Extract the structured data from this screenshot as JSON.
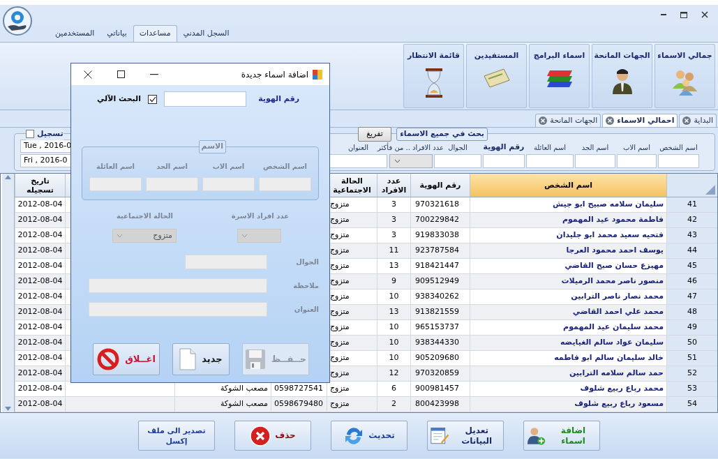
{
  "ribbon_tabs": [
    {
      "label": "السجل المدني",
      "selected": false
    },
    {
      "label": "مساعدات",
      "selected": true
    },
    {
      "label": "بياناتي",
      "selected": false
    },
    {
      "label": "المستخدمين",
      "selected": false
    }
  ],
  "ribbon_buttons": [
    {
      "label": "جمالي الاسماء"
    },
    {
      "label": "الجهات المانحة"
    },
    {
      "label": "اسماء البرامج"
    },
    {
      "label": "المستفيدين"
    },
    {
      "label": "قائمة الانتظار"
    }
  ],
  "doc_tabs": [
    {
      "label": "البداية",
      "selected": false
    },
    {
      "label": "احمالي الاسماء",
      "selected": true
    },
    {
      "label": "الجهات المانحة",
      "selected": false
    }
  ],
  "date_filter": {
    "title": "تسجيل",
    "checked": false,
    "dates": [
      "Tue , 2016-0",
      "Fri , 2016-0"
    ]
  },
  "search": {
    "title": "بحث في جميع الاسماء",
    "clear_button": "تفريغ",
    "fields": [
      {
        "label": "اسم الشخص",
        "kind": "text",
        "emphasis": false
      },
      {
        "label": "اسم الاب",
        "kind": "text",
        "emphasis": false
      },
      {
        "label": "اسم الجد",
        "kind": "text",
        "emphasis": false
      },
      {
        "label": "اسم العائلة",
        "kind": "text",
        "emphasis": false
      },
      {
        "label": "رقم الهوية",
        "kind": "text",
        "emphasis": true
      },
      {
        "label": "الجوال",
        "kind": "text",
        "emphasis": false
      },
      {
        "label": "عدد الافراد .. من فأكثر",
        "kind": "dropdown",
        "emphasis": false
      },
      {
        "label": "العنوان",
        "kind": "text",
        "emphasis": false
      }
    ]
  },
  "table": {
    "columns": [
      {
        "label": "اسم الشخص",
        "selected": true
      },
      {
        "label": "رقم الهوية",
        "selected": false
      },
      {
        "label": "عدد الافراد",
        "selected": false
      },
      {
        "label": "الحالة الاجتماعية",
        "selected": false
      },
      {
        "label": "تاريخ تسجيله",
        "selected": false
      }
    ],
    "rows": [
      {
        "number": "41",
        "name": "سليمان سلامه صبيح ابو جيش",
        "id": "970321618",
        "members": "3",
        "status": "متزوج",
        "date": "2012-08-04"
      },
      {
        "number": "42",
        "name": "فاطمة محمود عيد المهموم",
        "id": "700229842",
        "members": "3",
        "status": "متزوج",
        "date": "2012-08-04"
      },
      {
        "number": "43",
        "name": "فتحيه سعيد محمد ابو جليدان",
        "id": "919833038",
        "members": "3",
        "status": "متزوج",
        "date": "2012-08-04"
      },
      {
        "number": "44",
        "name": "يوسف احمد محمود العرجا",
        "id": "923787584",
        "members": "11",
        "status": "متزوج",
        "date": "2012-08-04"
      },
      {
        "number": "45",
        "name": "مهيزع حسان صبح القاضي",
        "id": "918421447",
        "members": "13",
        "status": "متزوج",
        "date": "2012-08-04"
      },
      {
        "number": "46",
        "name": "منصور ناصر محمد الرميلات",
        "id": "909512949",
        "members": "9",
        "status": "متزوج",
        "date": "2012-08-04"
      },
      {
        "number": "47",
        "name": "محمد نصار ناصر الترابين",
        "id": "938340262",
        "members": "10",
        "status": "متزوج",
        "date": "2012-08-04"
      },
      {
        "number": "48",
        "name": "محمد علي احمد القاضي",
        "id": "913821559",
        "members": "13",
        "status": "متزوج",
        "date": "2012-08-04"
      },
      {
        "number": "49",
        "name": "محمد سليمان عيد المهموم",
        "id": "965153737",
        "members": "10",
        "status": "متزوج",
        "date": "2012-08-04"
      },
      {
        "number": "50",
        "name": "سليمان عواد سالم الغيايضه",
        "id": "938344330",
        "members": "10",
        "status": "متزوج",
        "date": "2012-08-04"
      },
      {
        "number": "51",
        "name": "خالد سليمان سالم ابو فاطمه",
        "id": "905209680",
        "members": "10",
        "status": "متزوج",
        "date": "2012-08-04"
      },
      {
        "number": "52",
        "name": "حمد سالم سلامه الترابين",
        "id": "970320859",
        "members": "12",
        "status": "متزوج",
        "date": "2012-08-04"
      },
      {
        "number": "53",
        "name": "محمد رباع ربيع شلوف",
        "id": "900981457",
        "members": "6",
        "status": "متزوج",
        "phone": "0598727541",
        "contact": "مصعب الشوكة",
        "date": "2012-08-04"
      },
      {
        "number": "54",
        "name": "مسعود رباع ربيع شلوف",
        "id": "800423998",
        "members": "2",
        "status": "متزوج",
        "phone": "0598679480",
        "contact": "مصعب الشوكة",
        "date": "2012-08-04"
      }
    ]
  },
  "bottom_buttons": [
    {
      "label": "اضافة اسماء",
      "color": "#1f8a1f"
    },
    {
      "label": "تعديل البيانات",
      "color": "#1a2a6c"
    },
    {
      "label": "تحديث",
      "color": "#1f3f9a"
    },
    {
      "label": "حذف",
      "color": "#8b1010"
    },
    {
      "label": "تصدير الى ملف إكسل",
      "color": "#1f3f9a"
    }
  ],
  "dialog": {
    "title": "اضافة اسماء جديدة",
    "id_label": "رقم الهوية",
    "auto_search": {
      "label": "البحث الآلي",
      "checked": true
    },
    "name_group": {
      "title": "الاسم",
      "disabled": true,
      "fields": [
        "اسم الشخص",
        "اسم الاب",
        "اسم الجد",
        "اسم العائلة"
      ]
    },
    "family_size": {
      "label": "عدد افراد الاسرة",
      "disabled": true
    },
    "marital_status": {
      "label": "الحالة الاجتماعية",
      "value": "متزوج",
      "disabled": true
    },
    "fields": [
      {
        "label": "الجوال",
        "kind": "short",
        "disabled": true
      },
      {
        "label": "ملاحظة",
        "kind": "long",
        "disabled": true
      },
      {
        "label": "العنوان",
        "kind": "long",
        "disabled": true
      }
    ],
    "buttons": [
      {
        "label": "حــفــظ",
        "color": "#8d97a6",
        "disabled": true
      },
      {
        "label": "جديد",
        "color": "#111111",
        "disabled": false
      },
      {
        "label": "اغــلاق",
        "color": "#cc1133",
        "disabled": false
      }
    ]
  }
}
